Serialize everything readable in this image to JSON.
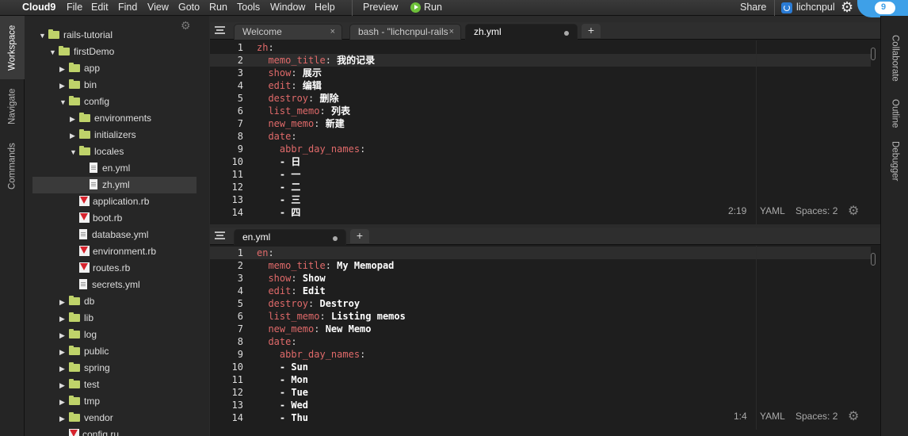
{
  "menubar": {
    "brand": "Cloud9",
    "items": [
      "File",
      "Edit",
      "Find",
      "View",
      "Goto",
      "Run",
      "Tools",
      "Window",
      "Help"
    ],
    "preview": "Preview",
    "run": "Run",
    "share": "Share",
    "user": "lichcnpul"
  },
  "left_tabs": [
    "Workspace",
    "Navigate",
    "Commands"
  ],
  "right_tabs": [
    "Collaborate",
    "Outline",
    "Debugger"
  ],
  "tree": [
    {
      "label": "rails-tutorial",
      "type": "folder",
      "open": true,
      "depth": 0
    },
    {
      "label": "firstDemo",
      "type": "folder",
      "open": true,
      "depth": 1
    },
    {
      "label": "app",
      "type": "folder",
      "open": false,
      "depth": 2
    },
    {
      "label": "bin",
      "type": "folder",
      "open": false,
      "depth": 2
    },
    {
      "label": "config",
      "type": "folder",
      "open": true,
      "depth": 2
    },
    {
      "label": "environments",
      "type": "folder",
      "open": false,
      "depth": 3
    },
    {
      "label": "initializers",
      "type": "folder",
      "open": false,
      "depth": 3
    },
    {
      "label": "locales",
      "type": "folder",
      "open": true,
      "depth": 3
    },
    {
      "label": "en.yml",
      "type": "file",
      "depth": 4
    },
    {
      "label": "zh.yml",
      "type": "file",
      "depth": 4,
      "selected": true
    },
    {
      "label": "application.rb",
      "type": "ruby",
      "depth": 3
    },
    {
      "label": "boot.rb",
      "type": "ruby",
      "depth": 3
    },
    {
      "label": "database.yml",
      "type": "file",
      "depth": 3
    },
    {
      "label": "environment.rb",
      "type": "ruby",
      "depth": 3
    },
    {
      "label": "routes.rb",
      "type": "ruby",
      "depth": 3
    },
    {
      "label": "secrets.yml",
      "type": "file",
      "depth": 3
    },
    {
      "label": "db",
      "type": "folder",
      "open": false,
      "depth": 2
    },
    {
      "label": "lib",
      "type": "folder",
      "open": false,
      "depth": 2
    },
    {
      "label": "log",
      "type": "folder",
      "open": false,
      "depth": 2
    },
    {
      "label": "public",
      "type": "folder",
      "open": false,
      "depth": 2
    },
    {
      "label": "spring",
      "type": "folder",
      "open": false,
      "depth": 2
    },
    {
      "label": "test",
      "type": "folder",
      "open": false,
      "depth": 2
    },
    {
      "label": "tmp",
      "type": "folder",
      "open": false,
      "depth": 2
    },
    {
      "label": "vendor",
      "type": "folder",
      "open": false,
      "depth": 2
    },
    {
      "label": "config.ru",
      "type": "ruby",
      "depth": 2
    }
  ],
  "editor_top": {
    "tabs": [
      {
        "label": "Welcome",
        "close": "×"
      },
      {
        "label": "bash - \"lichcnpul-rails",
        "close": "×"
      },
      {
        "label": "zh.yml",
        "active": true
      }
    ],
    "add": "+",
    "lines": [
      [
        [
          "k",
          "zh"
        ],
        [
          "p",
          ":"
        ]
      ],
      [
        [
          "t",
          "  "
        ],
        [
          "k",
          "memo_title"
        ],
        [
          "p",
          ": "
        ],
        [
          "t",
          "我的记录"
        ]
      ],
      [
        [
          "t",
          "  "
        ],
        [
          "k",
          "show"
        ],
        [
          "p",
          ": "
        ],
        [
          "t",
          "展示"
        ]
      ],
      [
        [
          "t",
          "  "
        ],
        [
          "k",
          "edit"
        ],
        [
          "p",
          ": "
        ],
        [
          "t",
          "编辑"
        ]
      ],
      [
        [
          "t",
          "  "
        ],
        [
          "k",
          "destroy"
        ],
        [
          "p",
          ": "
        ],
        [
          "t",
          "删除"
        ]
      ],
      [
        [
          "t",
          "  "
        ],
        [
          "k",
          "list_memo"
        ],
        [
          "p",
          ": "
        ],
        [
          "t",
          "列表"
        ]
      ],
      [
        [
          "t",
          "  "
        ],
        [
          "k",
          "new_memo"
        ],
        [
          "p",
          ": "
        ],
        [
          "t",
          "新建"
        ]
      ],
      [
        [
          "t",
          "  "
        ],
        [
          "k",
          "date"
        ],
        [
          "p",
          ":"
        ]
      ],
      [
        [
          "t",
          "    "
        ],
        [
          "k",
          "abbr_day_names"
        ],
        [
          "p",
          ":"
        ]
      ],
      [
        [
          "t",
          "    - 日"
        ]
      ],
      [
        [
          "t",
          "    - 一"
        ]
      ],
      [
        [
          "t",
          "    - 二"
        ]
      ],
      [
        [
          "t",
          "    - 三"
        ]
      ],
      [
        [
          "t",
          "    - 四"
        ]
      ]
    ],
    "highlight_line": 2,
    "status": {
      "position": "2:19",
      "mode": "YAML",
      "spaces": "Spaces: 2"
    }
  },
  "editor_bottom": {
    "tabs": [
      {
        "label": "en.yml",
        "active": true
      }
    ],
    "add": "+",
    "lines": [
      [
        [
          "k",
          "en"
        ],
        [
          "p",
          ":"
        ]
      ],
      [
        [
          "t",
          "  "
        ],
        [
          "k",
          "memo_title"
        ],
        [
          "p",
          ": "
        ],
        [
          "t",
          "My Memopad"
        ]
      ],
      [
        [
          "t",
          "  "
        ],
        [
          "k",
          "show"
        ],
        [
          "p",
          ": "
        ],
        [
          "t",
          "Show"
        ]
      ],
      [
        [
          "t",
          "  "
        ],
        [
          "k",
          "edit"
        ],
        [
          "p",
          ": "
        ],
        [
          "t",
          "Edit"
        ]
      ],
      [
        [
          "t",
          "  "
        ],
        [
          "k",
          "destroy"
        ],
        [
          "p",
          ": "
        ],
        [
          "t",
          "Destroy"
        ]
      ],
      [
        [
          "t",
          "  "
        ],
        [
          "k",
          "list_memo"
        ],
        [
          "p",
          ": "
        ],
        [
          "t",
          "Listing memos"
        ]
      ],
      [
        [
          "t",
          "  "
        ],
        [
          "k",
          "new_memo"
        ],
        [
          "p",
          ": "
        ],
        [
          "t",
          "New Memo"
        ]
      ],
      [
        [
          "t",
          "  "
        ],
        [
          "k",
          "date"
        ],
        [
          "p",
          ":"
        ]
      ],
      [
        [
          "t",
          "    "
        ],
        [
          "k",
          "abbr_day_names"
        ],
        [
          "p",
          ":"
        ]
      ],
      [
        [
          "t",
          "    - Sun"
        ]
      ],
      [
        [
          "t",
          "    - Mon"
        ]
      ],
      [
        [
          "t",
          "    - Tue"
        ]
      ],
      [
        [
          "t",
          "    - Wed"
        ]
      ],
      [
        [
          "t",
          "    - Thu"
        ]
      ]
    ],
    "highlight_line": 1,
    "status": {
      "position": "1:4",
      "mode": "YAML",
      "spaces": "Spaces: 2"
    }
  },
  "colors": {
    "key": "#e06a6a",
    "folder": "#bfd36a",
    "run": "#6ec13a",
    "brand": "#3ea0e8"
  }
}
